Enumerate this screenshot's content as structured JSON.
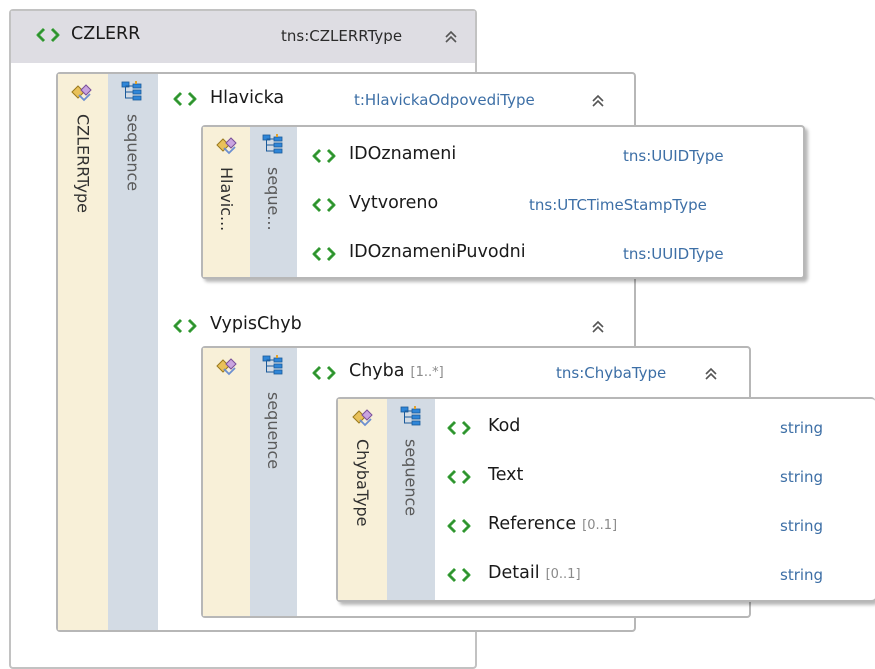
{
  "root": {
    "name": "CZLERR",
    "type": "tns:CZLERRType",
    "type_label": "CZLERRType",
    "sequence_label": "sequence"
  },
  "hlavicka": {
    "name": "Hlavicka",
    "type": "t:HlavickaOdpovediType",
    "type_label": "Hlavic...",
    "sequence_label": "seque...",
    "children": [
      {
        "name": "IDOznameni",
        "type": "tns:UUIDType"
      },
      {
        "name": "Vytvoreno",
        "type": "tns:UTCTimeStampType"
      },
      {
        "name": "IDOznameniPuvodni",
        "type": "tns:UUIDType"
      }
    ]
  },
  "vypis": {
    "name": "VypisChyb",
    "sequence_label": "sequence"
  },
  "chyba": {
    "name": "Chyba",
    "cardinality": "[1..*]",
    "type": "tns:ChybaType",
    "type_label": "ChybaType",
    "sequence_label": "sequence",
    "children": [
      {
        "name": "Kod",
        "cardinality": "",
        "type": "string"
      },
      {
        "name": "Text",
        "cardinality": "",
        "type": "string"
      },
      {
        "name": "Reference",
        "cardinality": "[0..1]",
        "type": "string"
      },
      {
        "name": "Detail",
        "cardinality": "[0..1]",
        "type": "string"
      }
    ]
  },
  "icons": {
    "element": "element-icon",
    "sequence": "sequence-icon",
    "complex_type": "complex-type-icon",
    "collapse": "collapse-chevron-icon"
  },
  "colors": {
    "type_text": "#3d6fa6",
    "element_icon": "#3aa53a",
    "type_strip": "#f8f0d8",
    "sequence_strip": "#d3dbe4",
    "header": "#dedde3",
    "border": "#b7b7b7"
  }
}
